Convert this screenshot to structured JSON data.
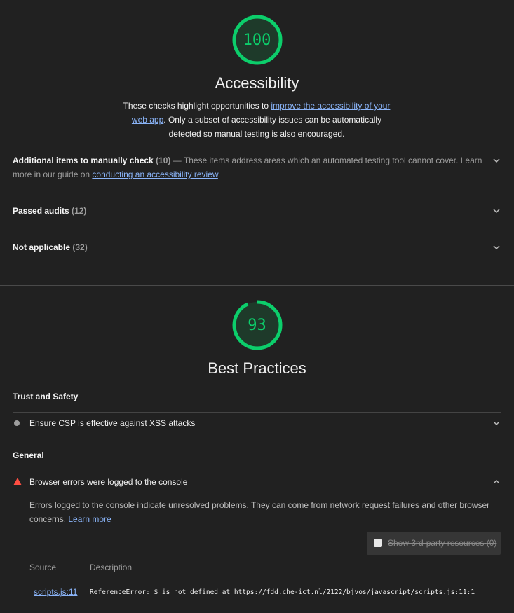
{
  "accessibility": {
    "score": "100",
    "score_fraction": 1.0,
    "title": "Accessibility",
    "desc_pre": "These checks highlight opportunities to ",
    "desc_link": "improve the accessibility of your web app",
    "desc_post": ". Only a subset of accessibility issues can be automatically detected so manual testing is also encouraged.",
    "groups": [
      {
        "label": "Additional items to manually check",
        "count": "(10)",
        "desc": " — These items address areas which an automated testing tool cannot cover. Learn more in our guide on ",
        "link": "conducting an accessibility review",
        "post": "."
      },
      {
        "label": "Passed audits",
        "count": "(12)"
      },
      {
        "label": "Not applicable",
        "count": "(32)"
      }
    ]
  },
  "best_practices": {
    "score": "93",
    "score_fraction": 0.93,
    "title": "Best Practices",
    "trust": {
      "label": "Trust and Safety",
      "audit": "Ensure CSP is effective against XSS attacks"
    },
    "general": {
      "label": "General",
      "audit": "Browser errors were logged to the console",
      "desc_pre": "Errors logged to the console indicate unresolved problems. They can come from network request failures and other browser concerns. ",
      "desc_link": "Learn more",
      "third_party_label": "Show 3rd-party resources",
      "third_party_count": "(0)",
      "col_source": "Source",
      "col_desc": "Description",
      "row_source": "scripts.js:11",
      "row_desc": "ReferenceError: $ is not defined at https://fdd.che-ict.nl/2122/bjvos/javascript/scripts.js:11:1"
    }
  },
  "colors": {
    "pass": "#0cce6b",
    "fail": "#ff4e42",
    "link": "#8ab4f8"
  }
}
